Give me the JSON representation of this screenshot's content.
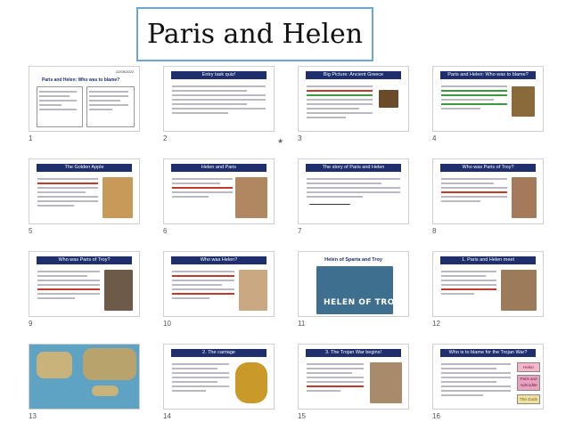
{
  "title": "Paris and Helen",
  "slides": [
    {
      "number": "1",
      "header": "Paris and Helen: Who was to blame?",
      "date": "22/05/2022"
    },
    {
      "number": "2",
      "header": "Entry task quiz!"
    },
    {
      "number": "3",
      "header": "Big Picture: Ancient Greece"
    },
    {
      "number": "4",
      "header": "Paris and Helen: Who was to blame?"
    },
    {
      "number": "5",
      "header": "The Golden Apple"
    },
    {
      "number": "6",
      "header": "Helen and Paris"
    },
    {
      "number": "7",
      "header": "The story of Paris and Helen"
    },
    {
      "number": "8",
      "header": "Who was Paris of Troy?"
    },
    {
      "number": "9",
      "header": "Who was Paris of Troy?"
    },
    {
      "number": "10",
      "header": "Who was Helen?"
    },
    {
      "number": "11",
      "header": "Helen of Sparta and Troy",
      "banner": "HELEN OF TROY"
    },
    {
      "number": "12",
      "header": "1. Paris and Helen meet"
    },
    {
      "number": "13",
      "header": ""
    },
    {
      "number": "14",
      "header": "2. The carriage"
    },
    {
      "number": "15",
      "header": "3. The Trojan War begins!"
    },
    {
      "number": "16",
      "header": "Who is to blame for the Trojan War?",
      "labels": [
        "Helen",
        "Paris and Aphrodite",
        "The Gods"
      ]
    }
  ]
}
